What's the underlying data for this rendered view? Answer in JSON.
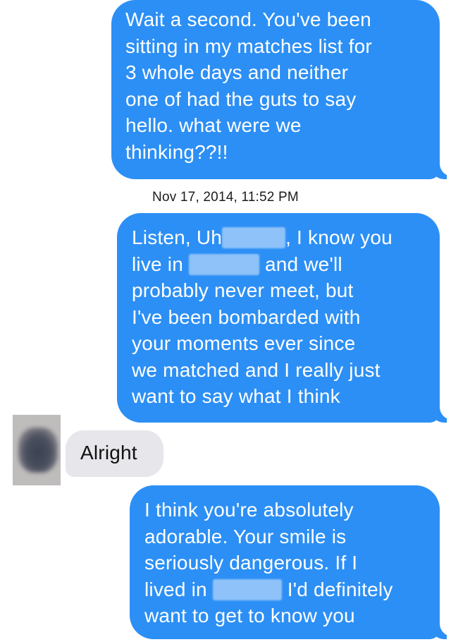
{
  "colors": {
    "sent_bubble": "#2c8ff5",
    "received_bubble": "#e6e6eb",
    "redaction": "#8fc2f8"
  },
  "messages": [
    {
      "direction": "sent",
      "lines": [
        "Wait a second.  You've been",
        "sitting in my matches list for",
        "3 whole days and neither",
        "one of had the guts to say",
        "hello. what were we",
        "thinking??!!"
      ]
    },
    {
      "timestamp": "Nov 17, 2014, 11:52 PM"
    },
    {
      "direction": "sent",
      "line1_a": "Listen, Uh",
      "line1_b": ", I know you",
      "line2_a": "live in",
      "line2_b": " and we'll",
      "lines_rest": [
        "probably never meet, but",
        "I've been bombarded with",
        "your moments ever since",
        "we matched and I really just",
        "want to say what I think"
      ]
    },
    {
      "direction": "received",
      "text": "Alright",
      "avatar_icon": "avatar-icon"
    },
    {
      "direction": "sent",
      "lines": [
        "I think you're absolutely",
        "adorable. Your smile is",
        "seriously dangerous. If I"
      ],
      "line4_a": "lived in",
      "line4_b": " I'd definitely",
      "line5": "want to get to know you"
    }
  ]
}
